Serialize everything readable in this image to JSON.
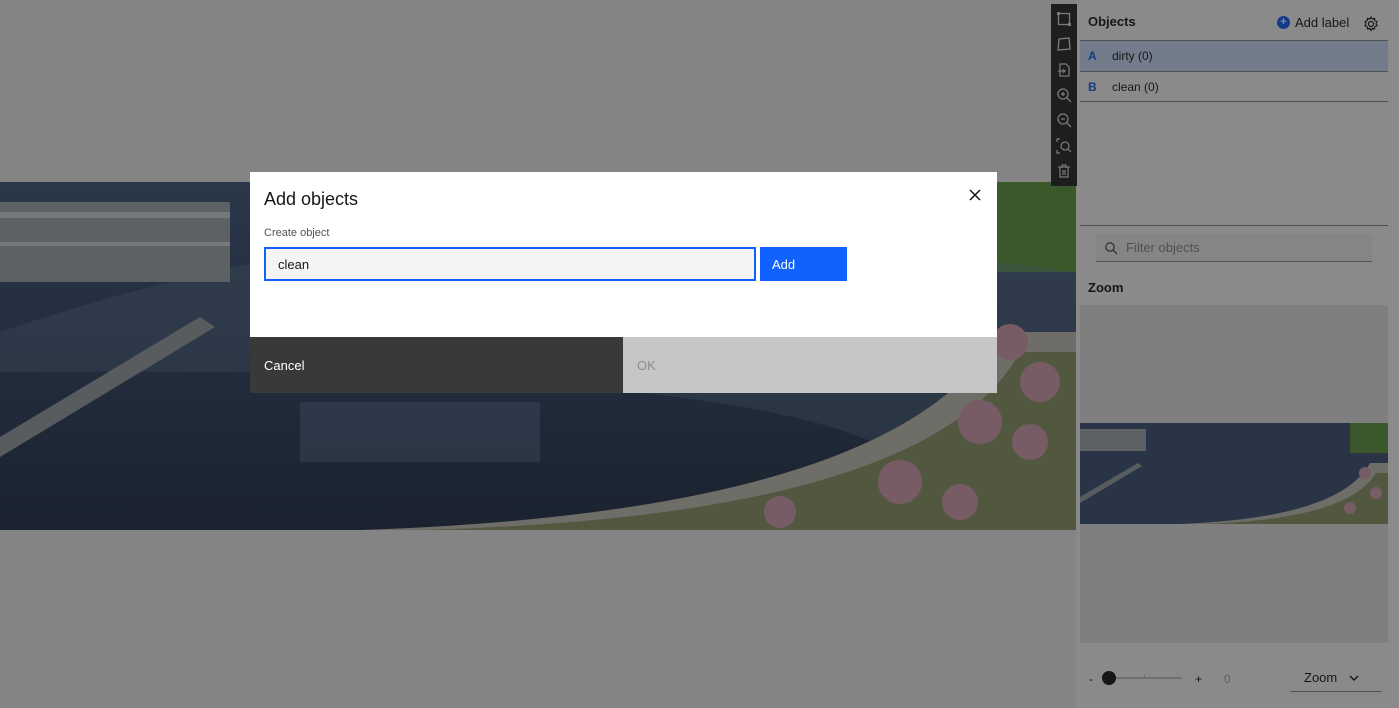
{
  "toolbar": {
    "tools": [
      "box-tool-icon",
      "polygon-tool-icon",
      "export-icon",
      "zoom-in-icon",
      "zoom-out-icon",
      "zoom-fit-icon",
      "trash-icon"
    ]
  },
  "objects_panel": {
    "title": "Objects",
    "add_label": "Add label",
    "items": [
      {
        "key": "A",
        "label": "dirty (0)",
        "selected": true
      },
      {
        "key": "B",
        "label": "clean (0)",
        "selected": false
      }
    ],
    "filter_placeholder": "Filter objects"
  },
  "zoom_panel": {
    "title": "Zoom",
    "minus": "-",
    "plus": "+",
    "value": "0",
    "select_value": "Zoom"
  },
  "modal": {
    "title": "Add objects",
    "field_label": "Create object",
    "input_value": "clean",
    "add_button": "Add",
    "cancel_button": "Cancel",
    "ok_button": "OK"
  },
  "colors": {
    "accent": "#0f62fe",
    "dark": "#393939",
    "disabled": "#c6c6c6"
  }
}
